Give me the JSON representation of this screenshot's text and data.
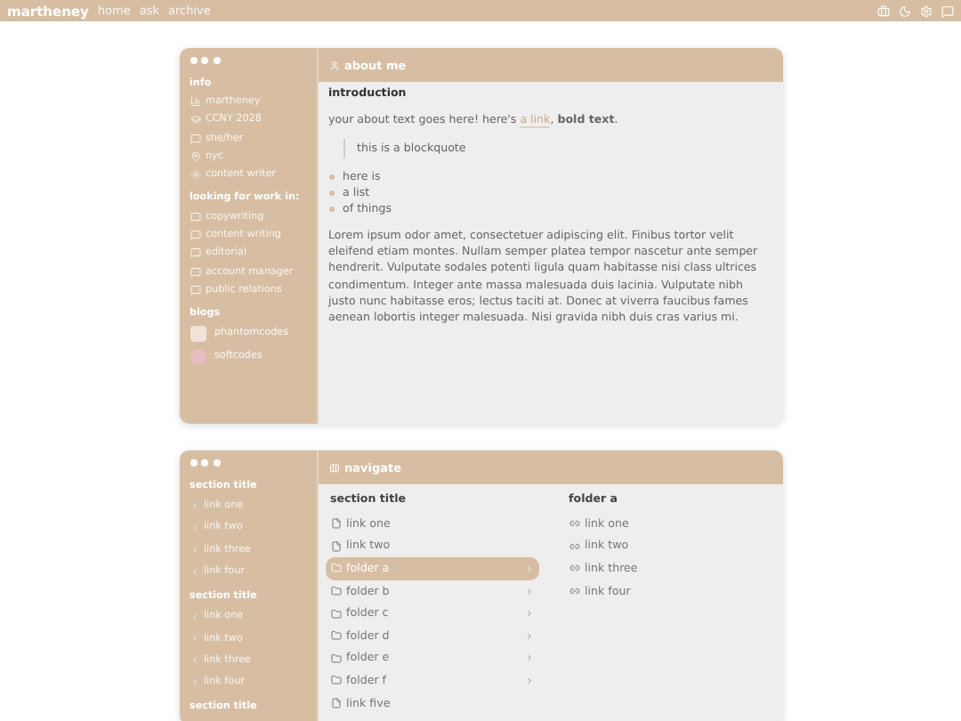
{
  "topbar": {
    "brand": "martheney",
    "links": [
      "home",
      "ask",
      "archive"
    ]
  },
  "about": {
    "sidebar": [
      {
        "title": "info",
        "items": [
          "martheney",
          "CCNY 2028",
          "she/her",
          "nyc",
          "content writer"
        ]
      },
      {
        "title": "looking for work in:",
        "items": [
          "copywriting",
          "content writing",
          "editorial",
          "account manager",
          "public relations"
        ]
      }
    ],
    "blogs_title": "blogs",
    "blogs": [
      {
        "name": "phantomcodes",
        "kind": "image"
      },
      {
        "name": "softcodes",
        "kind": "circle"
      }
    ],
    "header": "about me",
    "heading": "introduction",
    "intro": {
      "before": "your about text goes here! here's ",
      "link": "a link",
      "after": ", **bold text**."
    },
    "quote": "this is a blockquote",
    "list": [
      "here is",
      "a list",
      "of things"
    ],
    "paragraph": "Lorem ipsum odor amet, consectetuer adipiscing elit. Finibus tortor velit eleifend etiam montes. Nullam semper platea tempor nascetur ante semper hendrerit. Vulputate sodales potenti ligula quam habitasse nisi class ultrices condimentum. Integer ante massa malesuada duis lacinia. Vulputate nibh justo nunc habitasse eros; lectus taciti at. Donec at viverra faucibus fames aenean lobortis integer malesuada. Nisi gravida nibh duis cras varius mi."
  },
  "navigate": {
    "sidebar": [
      {
        "title": "section title",
        "items": [
          "link one",
          "link two",
          "link three",
          "link four"
        ]
      },
      {
        "title": "section title",
        "items": [
          "link one",
          "link two",
          "link three",
          "link four"
        ]
      },
      {
        "title": "section title"
      }
    ],
    "header": "navigate",
    "column_title": "section title",
    "entries": [
      {
        "label": "link one",
        "kind": "file",
        "selected": false
      },
      {
        "label": "link two",
        "kind": "file",
        "selected": false
      },
      {
        "label": "folder a",
        "kind": "folder",
        "selected": true
      },
      {
        "label": "folder b",
        "kind": "folder",
        "selected": false
      },
      {
        "label": "folder c",
        "kind": "folder",
        "selected": false
      },
      {
        "label": "folder d",
        "kind": "folder",
        "selected": false
      },
      {
        "label": "folder e",
        "kind": "folder",
        "selected": false
      },
      {
        "label": "folder f",
        "kind": "folder",
        "selected": false
      },
      {
        "label": "link five",
        "kind": "file",
        "selected": false
      }
    ],
    "folder_title": "folder a",
    "folder_links": [
      "link one",
      "link two",
      "link three",
      "link four"
    ]
  }
}
